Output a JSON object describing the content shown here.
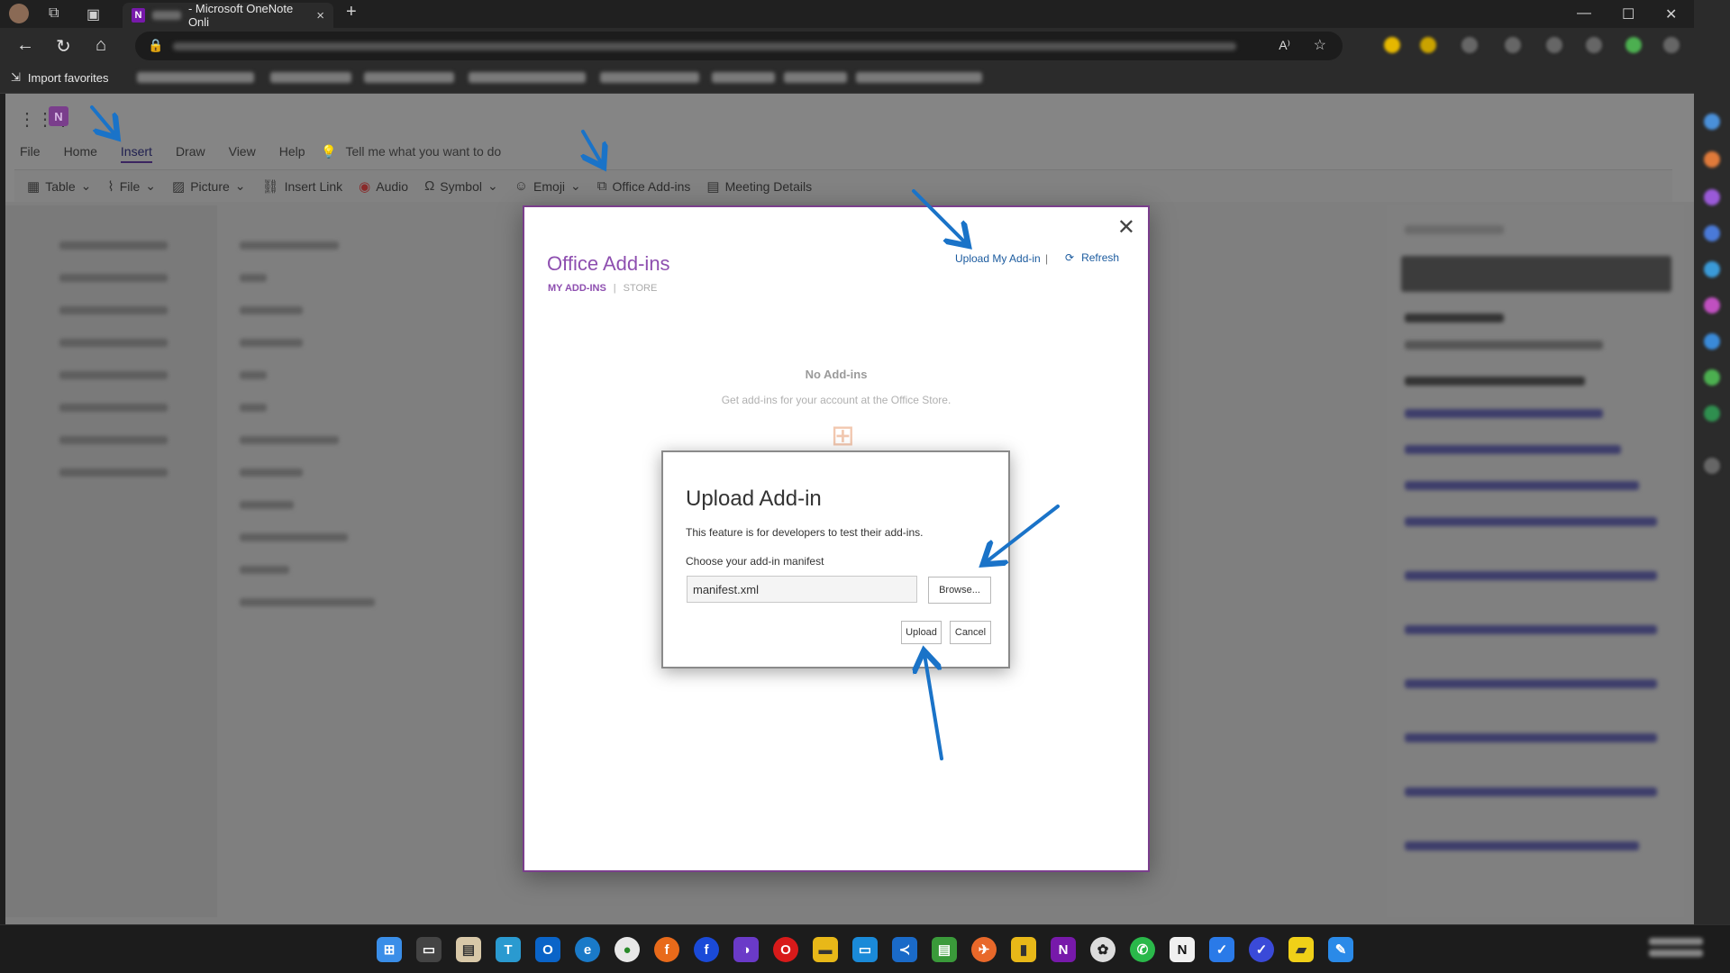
{
  "browser": {
    "tab_title": "- Microsoft OneNote Onli",
    "new_tab": "+",
    "close_tab": "×",
    "bookmark_import": "Import favorites",
    "read_aloud": "A⁾"
  },
  "app": {
    "menu": [
      "File",
      "Home",
      "Insert",
      "Draw",
      "View",
      "Help"
    ],
    "active_menu": "Insert",
    "tell_me": "Tell me what you want to do",
    "ribbon": {
      "table": "Table",
      "file": "File",
      "picture": "Picture",
      "insert_link": "Insert Link",
      "audio": "Audio",
      "symbol": "Symbol",
      "emoji": "Emoji",
      "office_addins": "Office Add-ins",
      "meeting_details": "Meeting Details"
    }
  },
  "addins_dialog": {
    "title": "Office Add-ins",
    "tab_my": "MY ADD-INS",
    "tab_sep": "|",
    "tab_store": "STORE",
    "upload_link": "Upload My Add-in",
    "sep": "|",
    "refresh": "Refresh",
    "empty_title": "No Add-ins",
    "empty_desc": "Get add-ins for your account at the Office Store."
  },
  "upload_dialog": {
    "heading": "Upload Add-in",
    "description": "This feature is for developers to test their add-ins.",
    "choose_label": "Choose your add-in manifest",
    "file_value": "manifest.xml",
    "browse": "Browse...",
    "upload": "Upload",
    "cancel": "Cancel"
  },
  "annotation_color": "#1a73c8"
}
